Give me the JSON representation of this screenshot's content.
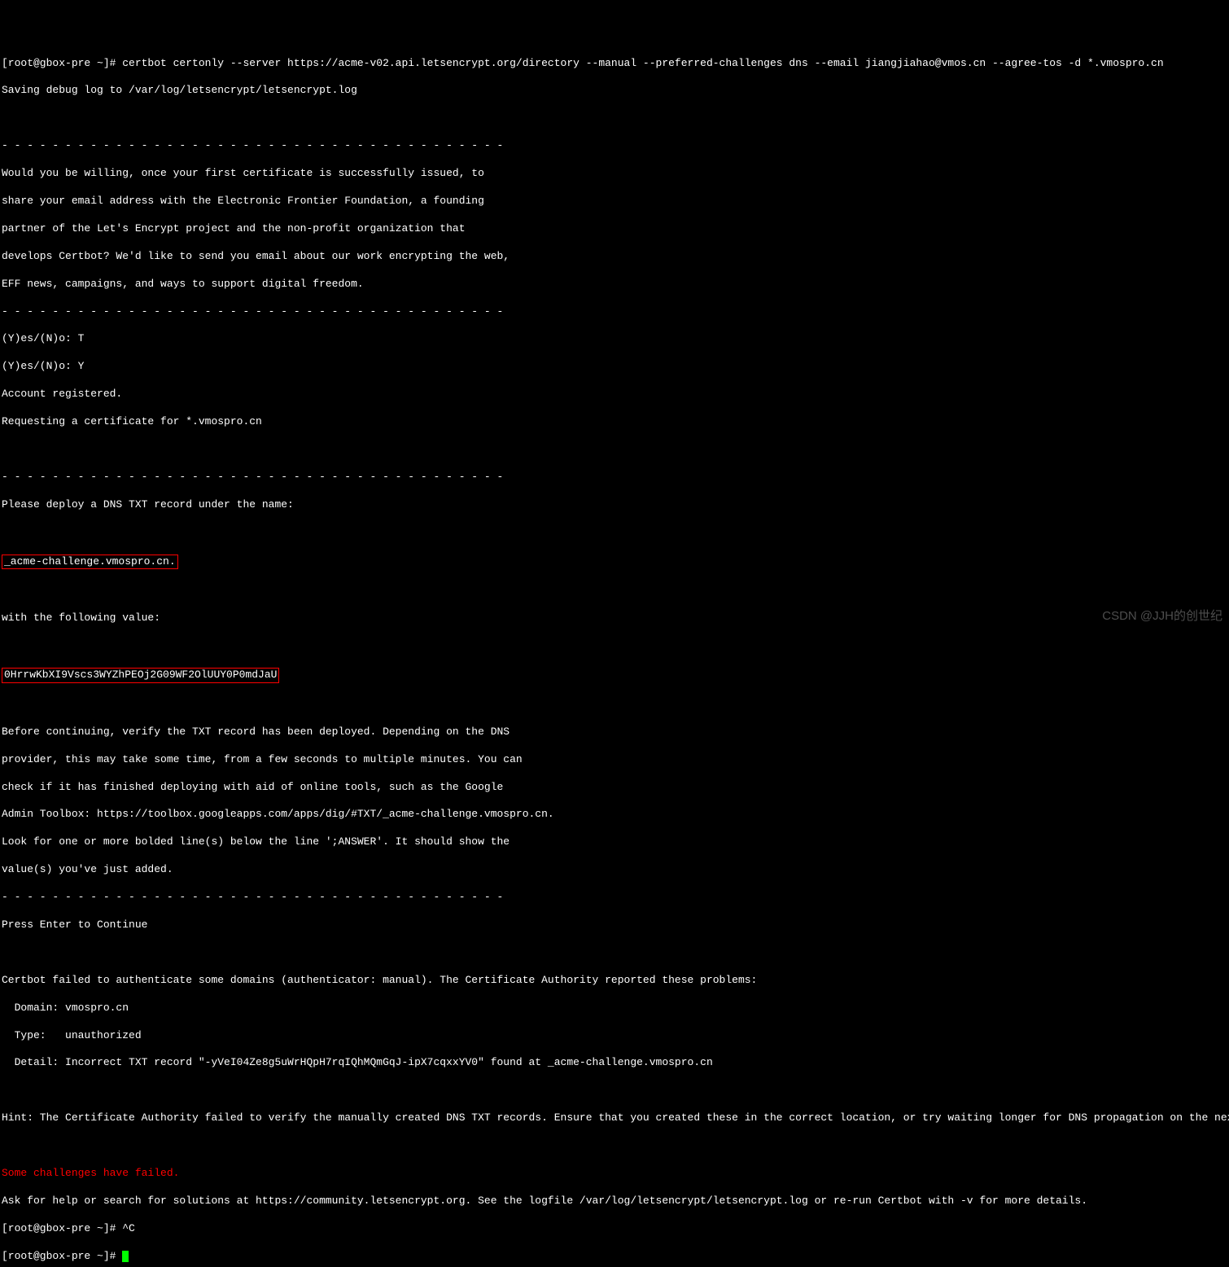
{
  "prompt1": "[root@gbox-pre ~]# certbot certonly --server https://acme-v02.api.letsencrypt.org/directory --manual --preferred-challenges dns --email jiangjiahao@vmos.cn --agree-tos -d *.vmospro.cn",
  "l1": "Saving debug log to /var/log/letsencrypt/letsencrypt.log",
  "blank": "",
  "sep": "- - - - - - - - - - - - - - - - - - - - - - - - - - - - - - - - - - - - - - - -",
  "p1": "Would you be willing, once your first certificate is successfully issued, to",
  "p2": "share your email address with the Electronic Frontier Foundation, a founding",
  "p3": "partner of the Let's Encrypt project and the non-profit organization that",
  "p4": "develops Certbot? We'd like to send you email about our work encrypting the web,",
  "p5": "EFF news, campaigns, and ways to support digital freedom.",
  "y1": "(Y)es/(N)o: T",
  "y2": "(Y)es/(N)o: Y",
  "acc": "Account registered.",
  "req": "Requesting a certificate for *.vmospro.cn",
  "dns": "Please deploy a DNS TXT record under the name:",
  "challenge": "_acme-challenge.vmospro.cn.",
  "following": "with the following value:",
  "token": "0HrrwKbXI9Vscs3WYZhPEOj2G09WF2OlUUY0P0mdJaU",
  "c1": "Before continuing, verify the TXT record has been deployed. Depending on the DNS",
  "c2": "provider, this may take some time, from a few seconds to multiple minutes. You can",
  "c3": "check if it has finished deploying with aid of online tools, such as the Google",
  "c4": "Admin Toolbox: https://toolbox.googleapps.com/apps/dig/#TXT/_acme-challenge.vmospro.cn.",
  "c5": "Look for one or more bolded line(s) below the line ';ANSWER'. It should show the",
  "c6": "value(s) you've just added.",
  "press": "Press Enter to Continue",
  "fail1": "Certbot failed to authenticate some domains (authenticator: manual). The Certificate Authority reported these problems:",
  "fail2": "  Domain: vmospro.cn",
  "fail3": "  Type:   unauthorized",
  "fail4": "  Detail: Incorrect TXT record \"-yVeI04Ze8g5uWrHQpH7rqIQhMQmGqJ-ipX7cqxxYV0\" found at _acme-challenge.vmospro.cn",
  "hint": "Hint: The Certificate Authority failed to verify the manually created DNS TXT records. Ensure that you created these in the correct location, or try waiting longer for DNS propagation on the next attempt.",
  "some": "Some challenges have failed.",
  "ask": "Ask for help or search for solutions at https://community.letsencrypt.org. See the logfile /var/log/letsencrypt/letsencrypt.log or re-run Certbot with -v for more details.",
  "prompt2": "[root@gbox-pre ~]# ^C",
  "prompt3": "[root@gbox-pre ~]# ",
  "watermark": "CSDN @JJH的创世纪"
}
